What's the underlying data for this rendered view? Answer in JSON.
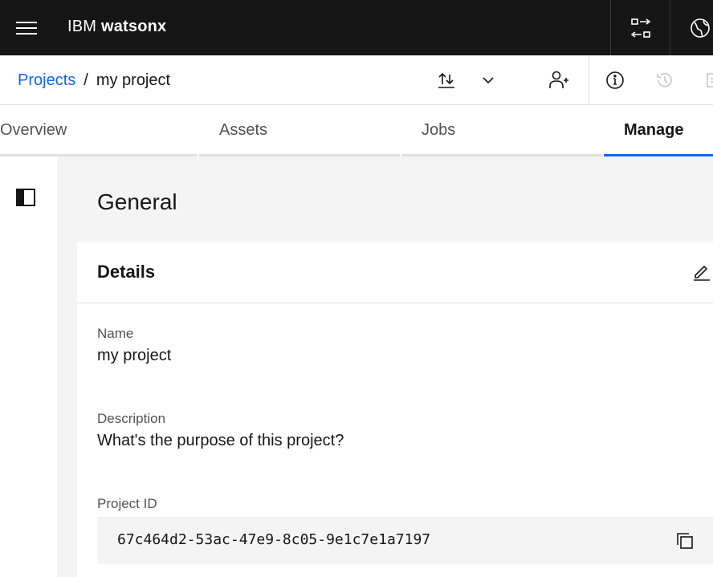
{
  "header": {
    "brand_prefix": "IBM",
    "brand_name": "watsonx"
  },
  "breadcrumb": {
    "root": "Projects",
    "separator": "/",
    "current": "my project"
  },
  "tabs": [
    {
      "label": "Overview",
      "active": false
    },
    {
      "label": "Assets",
      "active": false
    },
    {
      "label": "Jobs",
      "active": false
    },
    {
      "label": "Manage",
      "active": true
    }
  ],
  "page": {
    "title": "General"
  },
  "details": {
    "title": "Details",
    "name_label": "Name",
    "name_value": "my project",
    "description_label": "Description",
    "description_value": "What's the purpose of this project?",
    "id_label": "Project ID",
    "id_value": "67c464d2-53ac-47e9-8c05-9e1c7e1a7197"
  },
  "colors": {
    "header_bg": "#161616",
    "link": "#0f62fe",
    "active_tab_indicator": "#0f62fe"
  }
}
